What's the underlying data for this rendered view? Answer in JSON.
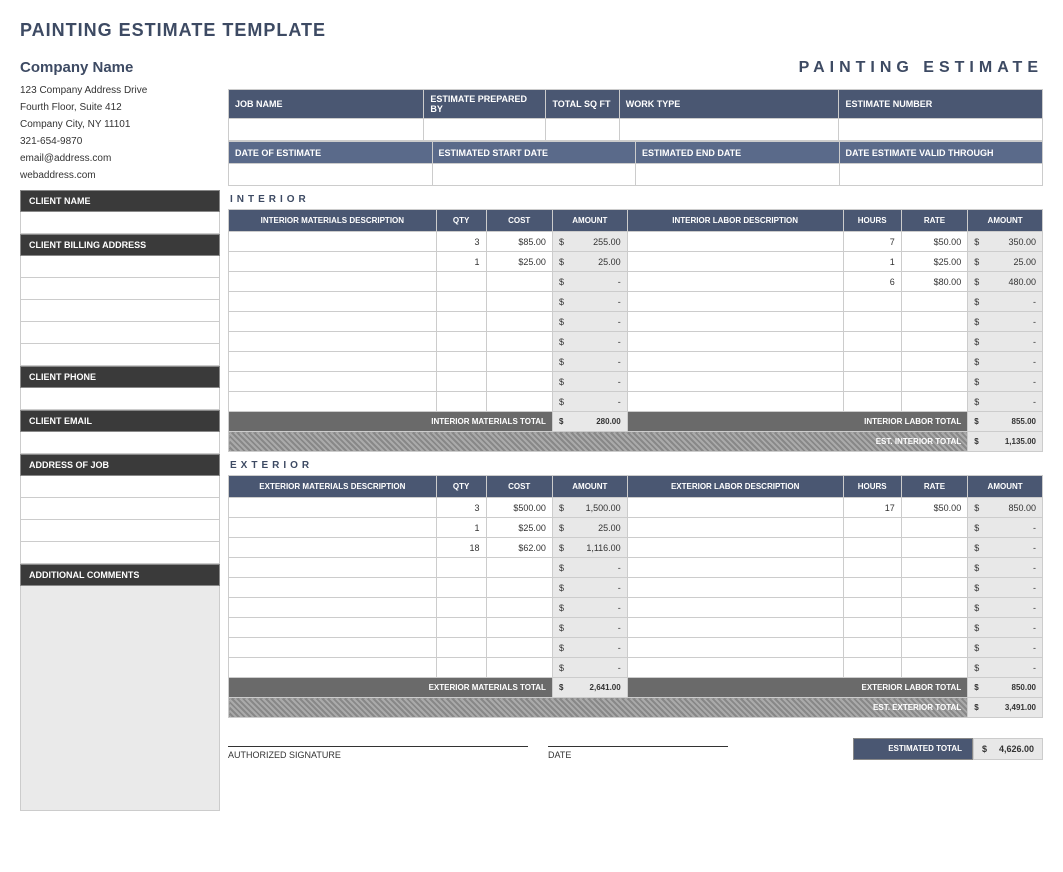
{
  "page_title": "PAINTING ESTIMATE TEMPLATE",
  "company": {
    "name": "Company Name",
    "addr1": "123 Company Address Drive",
    "addr2": "Fourth Floor, Suite 412",
    "city": "Company City, NY  11101",
    "phone": "321-654-9870",
    "email": "email@address.com",
    "web": "webaddress.com"
  },
  "sidebar": {
    "client_name": "CLIENT NAME",
    "billing": "CLIENT BILLING ADDRESS",
    "phone": "CLIENT PHONE",
    "email": "CLIENT EMAIL",
    "job_addr": "ADDRESS OF JOB",
    "comments": "ADDITIONAL COMMENTS"
  },
  "doc_title": "PAINTING ESTIMATE",
  "hdr1": {
    "job_name": "JOB NAME",
    "prepared_by": "ESTIMATE PREPARED BY",
    "sqft": "TOTAL SQ FT",
    "work_type": "WORK TYPE",
    "est_num": "ESTIMATE NUMBER"
  },
  "hdr2": {
    "date_est": "DATE OF ESTIMATE",
    "start": "ESTIMATED START DATE",
    "end": "ESTIMATED END DATE",
    "valid": "DATE ESTIMATE VALID THROUGH"
  },
  "sections": {
    "interior": "INTERIOR",
    "exterior": "EXTERIOR"
  },
  "cols": {
    "int_mat": "INTERIOR MATERIALS DESCRIPTION",
    "ext_mat": "EXTERIOR MATERIALS DESCRIPTION",
    "qty": "QTY",
    "cost": "COST",
    "amount": "AMOUNT",
    "int_lab": "INTERIOR LABOR DESCRIPTION",
    "ext_lab": "EXTERIOR LABOR DESCRIPTION",
    "hours": "HOURS",
    "rate": "RATE"
  },
  "interior": {
    "materials": [
      {
        "qty": "3",
        "cost": "85.00",
        "amount": "255.00"
      },
      {
        "qty": "1",
        "cost": "25.00",
        "amount": "25.00"
      },
      {
        "amount": "-"
      },
      {
        "amount": "-"
      },
      {
        "amount": "-"
      },
      {
        "amount": "-"
      },
      {
        "amount": "-"
      },
      {
        "amount": "-"
      },
      {
        "amount": "-"
      }
    ],
    "labor": [
      {
        "hours": "7",
        "rate": "50.00",
        "amount": "350.00"
      },
      {
        "hours": "1",
        "rate": "25.00",
        "amount": "25.00"
      },
      {
        "hours": "6",
        "rate": "80.00",
        "amount": "480.00"
      },
      {
        "amount": "-"
      },
      {
        "amount": "-"
      },
      {
        "amount": "-"
      },
      {
        "amount": "-"
      },
      {
        "amount": "-"
      },
      {
        "amount": "-"
      }
    ],
    "mat_total_label": "INTERIOR MATERIALS TOTAL",
    "mat_total": "280.00",
    "lab_total_label": "INTERIOR LABOR TOTAL",
    "lab_total": "855.00",
    "est_label": "EST. INTERIOR  TOTAL",
    "est_total": "1,135.00"
  },
  "exterior": {
    "materials": [
      {
        "qty": "3",
        "cost": "500.00",
        "amount": "1,500.00"
      },
      {
        "qty": "1",
        "cost": "25.00",
        "amount": "25.00"
      },
      {
        "qty": "18",
        "cost": "62.00",
        "amount": "1,116.00"
      },
      {
        "amount": "-"
      },
      {
        "amount": "-"
      },
      {
        "amount": "-"
      },
      {
        "amount": "-"
      },
      {
        "amount": "-"
      },
      {
        "amount": "-"
      }
    ],
    "labor": [
      {
        "hours": "17",
        "rate": "50.00",
        "amount": "850.00"
      },
      {
        "amount": "-"
      },
      {
        "amount": "-"
      },
      {
        "amount": "-"
      },
      {
        "amount": "-"
      },
      {
        "amount": "-"
      },
      {
        "amount": "-"
      },
      {
        "amount": "-"
      },
      {
        "amount": "-"
      }
    ],
    "mat_total_label": "EXTERIOR MATERIALS TOTAL",
    "mat_total": "2,641.00",
    "lab_total_label": "EXTERIOR LABOR TOTAL",
    "lab_total": "850.00",
    "est_label": "EST. EXTERIOR  TOTAL",
    "est_total": "3,491.00"
  },
  "footer": {
    "sig": "AUTHORIZED SIGNATURE",
    "date": "DATE",
    "est_total_label": "ESTIMATED TOTAL",
    "est_total": "4,626.00"
  },
  "dollar": "$"
}
